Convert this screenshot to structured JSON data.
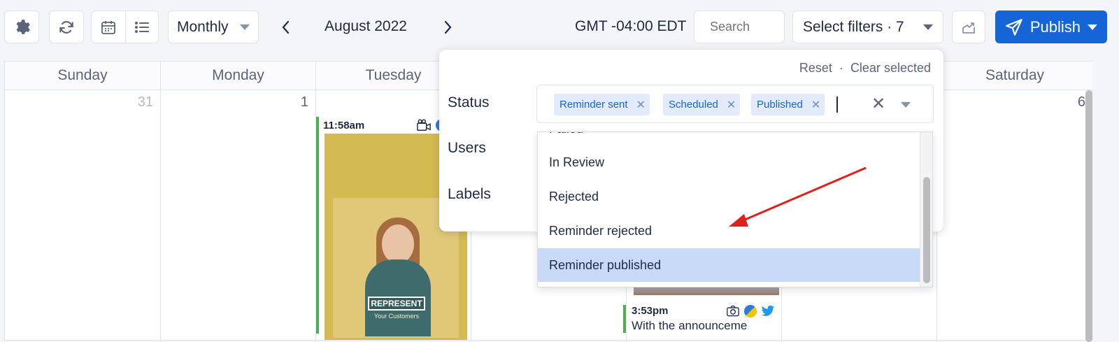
{
  "toolbar": {
    "view": "Monthly",
    "month": "August 2022",
    "timezone": "GMT -04:00 EDT",
    "search_placeholder": "Search",
    "filters_label": "Select filters · 7",
    "publish_label": "Publish"
  },
  "calendar": {
    "days": [
      "Sunday",
      "Monday",
      "Tuesday",
      "Saturday"
    ],
    "dates": {
      "sunday": "31",
      "monday": "1",
      "saturday": "6"
    },
    "posts": [
      {
        "time": "11:58am",
        "image_brand": "REPRESENT",
        "image_sub": "Your Customers"
      },
      {
        "time": "3:53pm",
        "text": "With the announceme"
      }
    ]
  },
  "filter_panel": {
    "reset": "Reset",
    "separator": "·",
    "clear_selected": "Clear selected",
    "labels": {
      "status": "Status",
      "users": "Users",
      "labels": "Labels"
    },
    "selected_status": [
      "Reminder sent",
      "Scheduled",
      "Published"
    ],
    "options": [
      "Failed",
      "In Review",
      "Rejected",
      "Reminder rejected",
      "Reminder published"
    ],
    "highlighted_option": "Reminder published"
  },
  "colors": {
    "accent": "#1565d8",
    "chip_bg": "#e3ebfa",
    "post_border": "#4caf50",
    "highlight": "#c9d9f8",
    "annotation_arrow": "#e0201b"
  }
}
